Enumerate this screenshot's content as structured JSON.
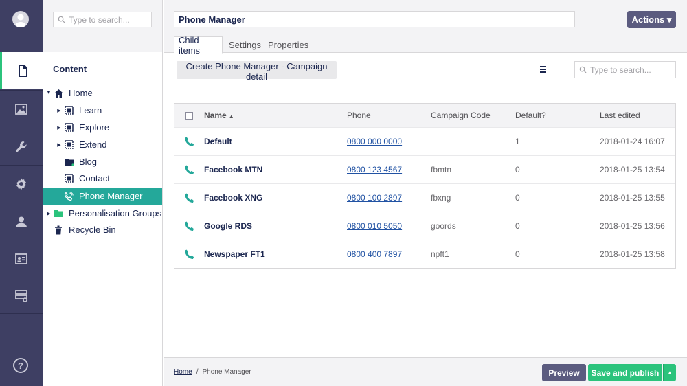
{
  "colors": {
    "rail": "#3e3f63",
    "accent": "#2bc37c",
    "selected": "#24a89a",
    "link": "#2152a3",
    "button_dark": "#5b5b7f"
  },
  "rail": {
    "items": [
      {
        "name": "content-section",
        "icon": "document-icon",
        "active": true
      },
      {
        "name": "media-section",
        "icon": "image-icon"
      },
      {
        "name": "settings-section",
        "icon": "wrench-icon"
      },
      {
        "name": "developer-section",
        "icon": "gear-icon"
      },
      {
        "name": "users-section",
        "icon": "user-icon"
      },
      {
        "name": "members-section",
        "icon": "id-card-icon"
      },
      {
        "name": "forms-section",
        "icon": "forms-icon"
      }
    ],
    "help": "?"
  },
  "tree": {
    "search_placeholder": "Type to search...",
    "heading": "Content",
    "items": [
      {
        "label": "Home",
        "icon": "home-icon",
        "caret": "open"
      },
      {
        "label": "Learn",
        "icon": "grid-icon",
        "caret": "closed"
      },
      {
        "label": "Explore",
        "icon": "grid-icon",
        "caret": "closed"
      },
      {
        "label": "Extend",
        "icon": "grid-icon",
        "caret": "closed"
      },
      {
        "label": "Blog",
        "icon": "folder-icon",
        "caret": ""
      },
      {
        "label": "Contact",
        "icon": "grid-icon",
        "caret": ""
      },
      {
        "label": "Phone Manager",
        "icon": "phone-icon",
        "caret": "",
        "selected": true
      },
      {
        "label": "Personalisation Groups",
        "icon": "folder-icon",
        "caret": "closed"
      },
      {
        "label": "Recycle Bin",
        "icon": "trash-icon",
        "caret": ""
      }
    ]
  },
  "header": {
    "node_name": "Phone Manager",
    "actions_label": "Actions ▾",
    "tabs": [
      "Child items",
      "Settings",
      "Properties"
    ]
  },
  "list": {
    "create_label": "Create Phone Manager - Campaign detail",
    "search_placeholder": "Type to search...",
    "columns": {
      "name": "Name",
      "phone": "Phone",
      "code": "Campaign Code",
      "default": "Default?",
      "edited": "Last edited"
    },
    "sort_glyph": "▲",
    "rows": [
      {
        "name": "Default",
        "phone": "0800 000 0000",
        "code": "",
        "default": "1",
        "edited": "2018-01-24 16:07"
      },
      {
        "name": "Facebook MTN",
        "phone": "0800 123 4567",
        "code": "fbmtn",
        "default": "0",
        "edited": "2018-01-25 13:54"
      },
      {
        "name": "Facebook XNG",
        "phone": "0800 100 2897",
        "code": "fbxng",
        "default": "0",
        "edited": "2018-01-25 13:55"
      },
      {
        "name": "Google RDS",
        "phone": "0800 010 5050",
        "code": "goords",
        "default": "0",
        "edited": "2018-01-25 13:56"
      },
      {
        "name": "Newspaper FT1",
        "phone": "0800 400 7897",
        "code": "npft1",
        "default": "0",
        "edited": "2018-01-25 13:58"
      }
    ]
  },
  "footer": {
    "breadcrumb": [
      "Home",
      "Phone Manager"
    ],
    "separator": "/",
    "preview_label": "Preview",
    "publish_label": "Save and publish",
    "publish_caret": "▲"
  }
}
